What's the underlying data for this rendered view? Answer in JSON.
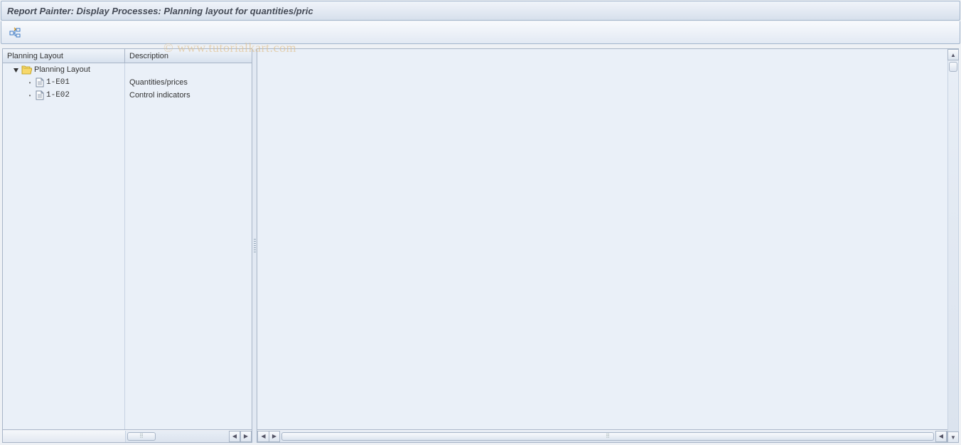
{
  "title": "Report Painter: Display Processes: Planning layout for quantities/pric",
  "watermark": "© www.tutorialkart.com",
  "toolbar": {
    "expand_tooltip": "Expand"
  },
  "tree": {
    "headers": {
      "col1": "Planning Layout",
      "col2": "Description"
    },
    "root": {
      "label": "Planning Layout",
      "desc": ""
    },
    "items": [
      {
        "code": "1-E01",
        "desc": "Quantities/prices"
      },
      {
        "code": "1-E02",
        "desc": "Control indicators"
      }
    ]
  }
}
